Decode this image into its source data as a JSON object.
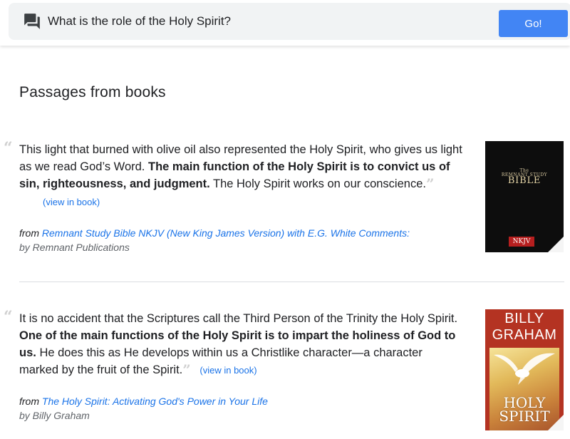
{
  "search": {
    "query": "What is the role of the Holy Spirit?",
    "go_label": "Go!"
  },
  "section_title": "Passages from books",
  "view_in_book_label": "(view in book)",
  "from_label": "from",
  "passages": [
    {
      "text_before": "This light that burned with olive oil also represented the Holy Spirit, who gives us light as we read God’s Word.",
      "text_bold": "The main function of the Holy Spirit is to convict us of sin, righteousness, and judgment.",
      "text_after": "The Holy Spirit works on our conscience.",
      "book_title": "Remnant Study Bible NKJV (New King James Version) with E.G. White Comments:",
      "byline": "by Remnant Publications",
      "cover": {
        "small_top": "The",
        "small_line": "REMNANT STUDY",
        "title": "BIBLE",
        "badge": "NKJV"
      }
    },
    {
      "text_before": "It is no accident that the Scriptures call the Third Person of the Trinity the Holy Spirit.",
      "text_bold": "One of the main functions of the Holy Spirit is to impart the holiness of God to us.",
      "text_after": "He does this as He develops within us a Christlike character—a character marked by the fruit of the Spirit.",
      "book_title": "The Holy Spirit: Activating God's Power in Your Life",
      "byline": "by Billy Graham",
      "cover": {
        "author_line1": "BILLY",
        "author_line2": "GRAHAM",
        "title_line1": "HOLY",
        "title_line2": "SPIRIT"
      }
    }
  ],
  "colors": {
    "accent": "#4285f4",
    "link": "#1a73e8",
    "search_bg": "#f1f3f4"
  },
  "icons": {
    "search_leading": "chat-bubbles-icon"
  }
}
